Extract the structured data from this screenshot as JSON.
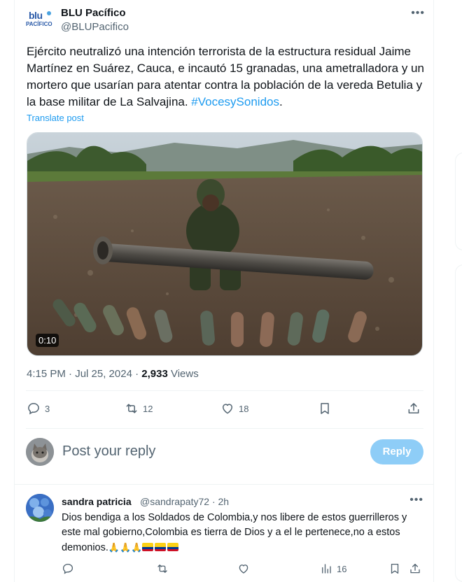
{
  "post": {
    "author_name": "BLU Pacífico",
    "author_handle": "@BLUPacifico",
    "logo_text_top": "blu",
    "logo_text_bottom": "PACÍFICO",
    "text_main": "Ejército neutralizó una intención terrorista de la estructura residual Jaime Martínez en Suárez, Cauca, e incautó 15 granadas, una ametralladora y un mortero que usarían para atentar contra la población de la vereda Betulia y la base militar de La Salvajina. ",
    "hashtag": "#VocesySonidos",
    "text_end": ".",
    "translate_label": "Translate post",
    "video_duration": "0:10",
    "timestamp": "4:15 PM · Jul 25, 2024 · ",
    "views_count": "2,933",
    "views_label": " Views",
    "replies": "3",
    "reposts": "12",
    "likes": "18"
  },
  "reply_composer": {
    "placeholder": "Post your reply",
    "button_label": "Reply"
  },
  "comment": {
    "author_name": "sandra patricia",
    "author_handle": "@sandrapaty72 · 2h",
    "text": "Dios bendiga a los Soldados de Colombia,y nos libere de estos guerrilleros y este mal gobierno,Colombia es tierra de Dios y a el le pertenece,no a estos demonios.",
    "emoji_hands": "🙏🙏🙏",
    "views": "16"
  },
  "colors": {
    "accent": "#1d9bf0",
    "reply_button": "#8ecdf7",
    "muted": "#536471"
  }
}
